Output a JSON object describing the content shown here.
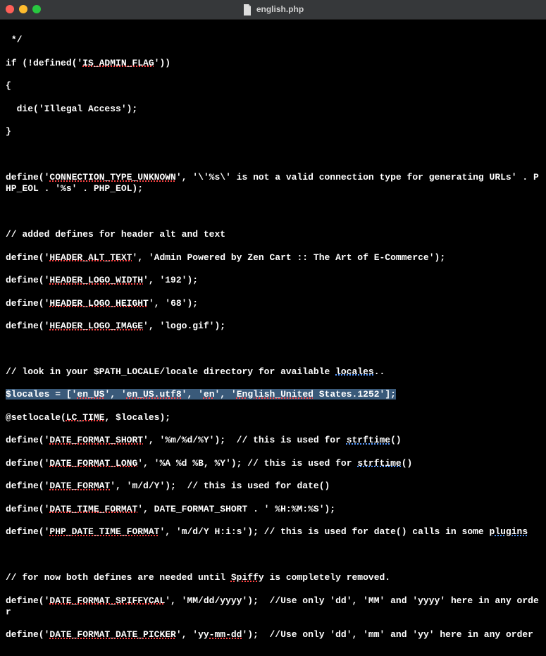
{
  "titlebar": {
    "filename": "english.php"
  },
  "code": {
    "l1": " */",
    "l2a": "if (!defined('",
    "l2b": "IS_ADMIN_FLAG",
    "l2c": "'))",
    "l3": "{",
    "l4": "  die('Illegal Access');",
    "l5": "}",
    "l6": "",
    "l7a": "define('",
    "l7b": "CONNECTION_TYPE_UNKNOWN",
    "l7c": "', '\\'%s\\' is not a valid connection type for generating URLs' . PHP_EOL . '%s' . PHP_EOL);",
    "l8": "",
    "l9": "// added defines for header alt and text",
    "l10a": "define('",
    "l10b": "HEADER_ALT_TEXT",
    "l10c": "', 'Admin Powered by Zen Cart :: The Art of E-Commerce');",
    "l11a": "define('",
    "l11b": "HEADER_LOGO_WIDTH",
    "l11c": "', '192');",
    "l12a": "define('",
    "l12b": "HEADER_LOGO_HEIGHT",
    "l12c": "', '68');",
    "l13a": "define('",
    "l13b": "HEADER_LOGO_IMAGE",
    "l13c": "', 'logo.gif');",
    "l14": "",
    "l15a": "// look in your $PATH_LOCALE/locale directory for available ",
    "l15b": "locales",
    "l15c": "..",
    "l16a": "$locales = ['",
    "l16b": "en_US",
    "l16c": "', '",
    "l16d": "en_US.utf8",
    "l16e": "', '",
    "l16f": "en",
    "l16g": "', '",
    "l16h": "English_United",
    "l16i": " States.1252'];",
    "l17a": "@setlocale(",
    "l17b": "LC_TIME",
    "l17c": ", $locales);",
    "l18a": "define('",
    "l18b": "DATE_FORMAT_SHORT",
    "l18c": "', '%m/%d/%Y');  // this is used for ",
    "l18d": "strftime",
    "l18e": "()",
    "l19a": "define('",
    "l19b": "DATE_FORMAT_LONG",
    "l19c": "', '%A %d %B, %Y'); // this is used for ",
    "l19d": "strftime",
    "l19e": "()",
    "l20a": "define('",
    "l20b": "DATE_FORMAT",
    "l20c": "', 'm/d/Y');  // this is used for date()",
    "l21a": "define('",
    "l21b": "DATE_TIME_FORMAT",
    "l21c": "', DATE_FORMAT_SHORT . ' %H:%M:%S');",
    "l22a": "define('",
    "l22b": "PHP_DATE_TIME_FORMAT",
    "l22c": "', 'm/d/Y H:i:s'); // this is used for date() calls in some ",
    "l22d": "plugins",
    "l23": "",
    "l24a": "// for now both defines are needed until ",
    "l24b": "Spiffy",
    "l24c": " is completely removed.",
    "l25a": "define('",
    "l25b": "DATE_FORMAT_SPIFFYCAL",
    "l25c": "', 'MM/dd/",
    "l25d": "yyyy",
    "l25e": "');  //Use only 'dd', 'MM' and '",
    "l25f": "yyyy",
    "l25g": "' here in any order",
    "l26a": "define('",
    "l26b": "DATE_FORMAT_DATE_PICKER",
    "l26c": "', '",
    "l26d": "yy-mm-dd",
    "l26e": "');  //Use only 'dd', 'mm' and '",
    "l26f": "yy",
    "l26g": "' here in any order"
  }
}
